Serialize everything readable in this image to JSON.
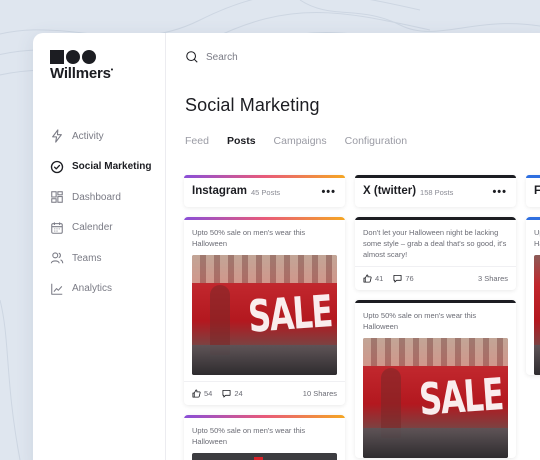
{
  "brand": {
    "name": "Willmers"
  },
  "sidebar": {
    "items": [
      {
        "label": "Activity",
        "icon": "bolt-icon",
        "active": false
      },
      {
        "label": "Social Marketing",
        "icon": "check-circle-icon",
        "active": true
      },
      {
        "label": "Dashboard",
        "icon": "dashboard-grid-icon",
        "active": false
      },
      {
        "label": "Calender",
        "icon": "calendar-icon",
        "active": false
      },
      {
        "label": "Teams",
        "icon": "users-icon",
        "active": false
      },
      {
        "label": "Analytics",
        "icon": "chart-line-icon",
        "active": false
      }
    ]
  },
  "search": {
    "placeholder": "Search"
  },
  "page": {
    "title": "Social Marketing"
  },
  "tabs": [
    {
      "label": "Feed",
      "active": false
    },
    {
      "label": "Posts",
      "active": true
    },
    {
      "label": "Campaigns",
      "active": false
    },
    {
      "label": "Configuration",
      "active": false
    }
  ],
  "columns": [
    {
      "name": "Instagram",
      "count": "45 Posts",
      "menu": "•••",
      "accent": "#8a4fd8",
      "cards": [
        {
          "text": "Upto 50% sale on men's wear this Halloween",
          "likes": "54",
          "comments": "24",
          "shares": "10 Shares",
          "image": "sale-photo"
        },
        {
          "text": "Upto 50% sale on men's wear this Halloween",
          "image": "dark-photo"
        }
      ]
    },
    {
      "name": "X (twitter)",
      "count": "158 Posts",
      "menu": "•••",
      "accent": "#1c1d22",
      "cards": [
        {
          "text": "Don't let your Halloween night be lacking some style – grab a deal that's so good, it's almost scary!",
          "likes": "41",
          "comments": "76",
          "shares": "3 Shares"
        },
        {
          "text": "Upto 50% sale on men's wear this Halloween",
          "image": "sale-photo"
        }
      ]
    },
    {
      "name": "Fa",
      "accent": "#2f6fe0",
      "cards": [
        {
          "text": "Up Ha"
        }
      ]
    }
  ],
  "colors": {
    "instagram_gradient": [
      "#8a4fd8",
      "#e85a7a",
      "#f5a623"
    ],
    "twitter": "#1c1d22",
    "facebook": "#2f6fe0"
  }
}
